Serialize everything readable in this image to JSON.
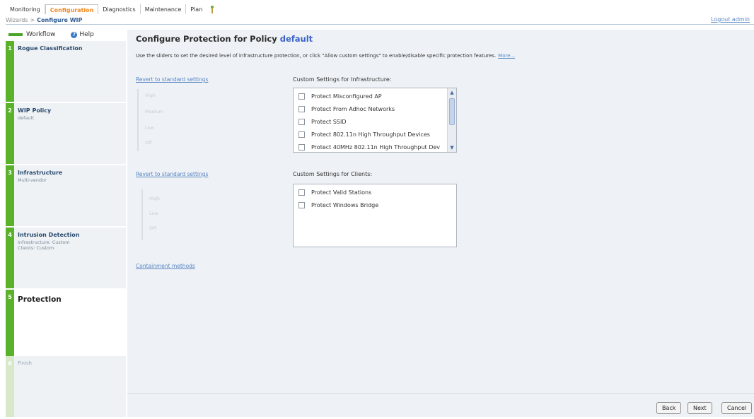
{
  "nav": {
    "tabs": [
      "Monitoring",
      "Configuration",
      "Diagnostics",
      "Maintenance",
      "Plan"
    ],
    "active": "Configuration",
    "logout": "Logout admin"
  },
  "breadcrumb": {
    "root": "Wizards",
    "sep": ">",
    "current": "Configure WIP"
  },
  "sidebar": {
    "workflow_label": "Workflow",
    "help_label": "Help",
    "steps": [
      {
        "num": "1",
        "title": "Rogue Classification",
        "sub": ""
      },
      {
        "num": "2",
        "title": "WIP Policy",
        "sub": "default"
      },
      {
        "num": "3",
        "title": "Infrastructure",
        "sub": "Multi-vendor"
      },
      {
        "num": "4",
        "title": "Intrusion Detection",
        "sub": "Infrastructure: Custom\nClients: Custom"
      },
      {
        "num": "5",
        "title": "Protection",
        "sub": ""
      },
      {
        "num": "6",
        "title": "Finish",
        "sub": ""
      }
    ]
  },
  "main": {
    "heading_prefix": "Configure Protection for Policy",
    "policy_name": "default",
    "intro": "Use the sliders to set the desired level of infrastructure protection, or click \"Allow custom settings\" to enable/disable specific protection features.",
    "more": "More...",
    "infra": {
      "revert": "Revert to standard settings",
      "slider_levels": [
        "High",
        "Medium",
        "Low",
        "Off"
      ],
      "panel_title": "Custom Settings for Infrastructure:",
      "items": [
        "Protect Misconfigured AP",
        "Protect From Adhoc Networks",
        "Protect SSID",
        "Protect 802.11n High Throughput Devices",
        "Protect 40MHz 802.11n High Throughput Dev"
      ]
    },
    "clients": {
      "revert": "Revert to standard settings",
      "slider_levels": [
        "High",
        "Low",
        "Off"
      ],
      "panel_title": "Custom Settings for Clients:",
      "items": [
        "Protect Valid Stations",
        "Protect Windows Bridge"
      ]
    },
    "containment": "Containment methods"
  },
  "buttons": {
    "back": "Back",
    "next": "Next",
    "cancel": "Cancel"
  },
  "colors": {
    "accent_orange": "#f08a24",
    "step_green": "#5ab22a",
    "link_blue": "#5a86c3",
    "policy_blue": "#3a62c4"
  }
}
